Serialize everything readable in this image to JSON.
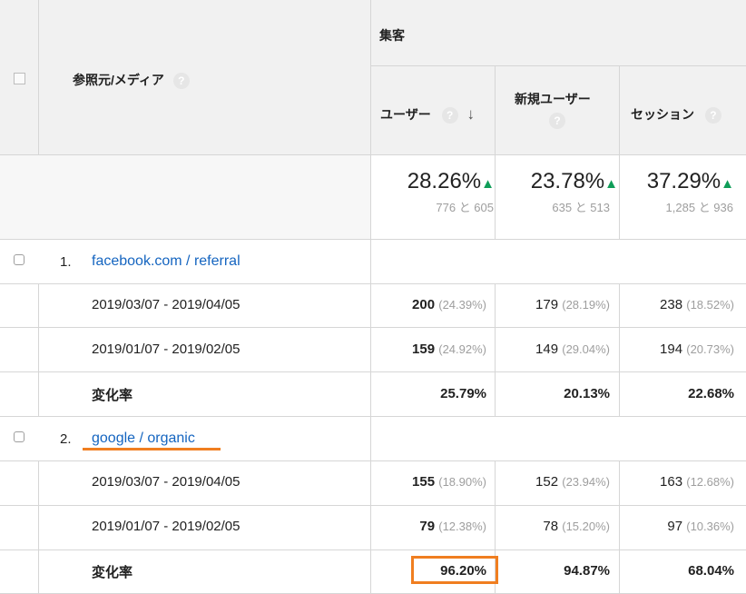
{
  "header": {
    "group_label": "集客",
    "dimension_label": "参照元/メディア",
    "help_glyph": "?",
    "sort_arrow": "↓",
    "columns": [
      {
        "label": "ユーザー"
      },
      {
        "label": "新規ユーザー"
      },
      {
        "label": "セッション"
      }
    ]
  },
  "summary": [
    {
      "change": "28.26%",
      "compare": "776 と 605"
    },
    {
      "change": "23.78%",
      "compare": "635 と 513"
    },
    {
      "change": "37.29%",
      "compare": "1,285 と 936"
    }
  ],
  "summary_arrow": "▲",
  "rows": [
    {
      "index": "1.",
      "name": "facebook.com / referral",
      "periods": [
        {
          "label": "2019/03/07 - 2019/04/05",
          "values": [
            {
              "v": "200",
              "p": "(24.39%)"
            },
            {
              "v": "179",
              "p": "(28.19%)"
            },
            {
              "v": "238",
              "p": "(18.52%)"
            }
          ]
        },
        {
          "label": "2019/01/07 - 2019/02/05",
          "values": [
            {
              "v": "159",
              "p": "(24.92%)"
            },
            {
              "v": "149",
              "p": "(29.04%)"
            },
            {
              "v": "194",
              "p": "(20.73%)"
            }
          ]
        }
      ],
      "change_label": "変化率",
      "change": [
        "25.79%",
        "20.13%",
        "22.68%"
      ]
    },
    {
      "index": "2.",
      "name": "google / organic",
      "periods": [
        {
          "label": "2019/03/07 - 2019/04/05",
          "values": [
            {
              "v": "155",
              "p": "(18.90%)"
            },
            {
              "v": "152",
              "p": "(23.94%)"
            },
            {
              "v": "163",
              "p": "(12.68%)"
            }
          ]
        },
        {
          "label": "2019/01/07 - 2019/02/05",
          "values": [
            {
              "v": "79",
              "p": "(12.38%)"
            },
            {
              "v": "78",
              "p": "(15.20%)"
            },
            {
              "v": "97",
              "p": "(10.36%)"
            }
          ]
        }
      ],
      "change_label": "変化率",
      "change": [
        "96.20%",
        "94.87%",
        "68.04%"
      ]
    }
  ],
  "colors": {
    "highlight": "#f07e20",
    "link": "#1565c0",
    "up_arrow": "#0f9d58",
    "header_bg": "#f1f1f1"
  }
}
